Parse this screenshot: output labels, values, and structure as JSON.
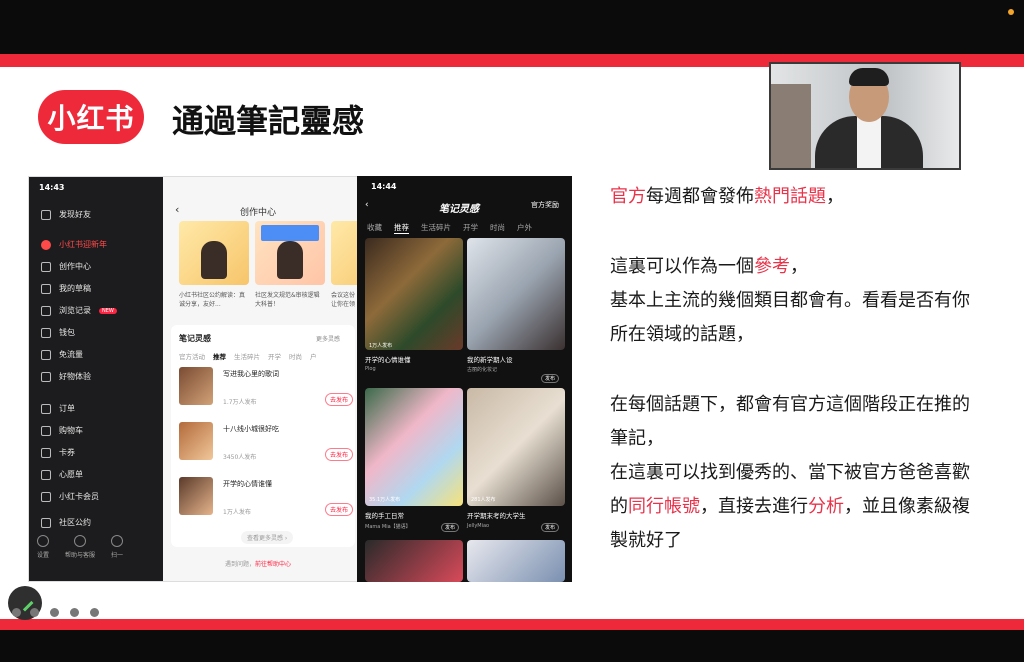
{
  "slide": {
    "logo_text": "小红书",
    "title": "通過筆記靈感",
    "accent_color": "#ee2a3a"
  },
  "phone_left": {
    "status_time": "14:43",
    "menu": [
      {
        "label": "发现好友",
        "icon": "add-friend-icon"
      },
      {
        "label": "小红书迎新年",
        "icon": "lantern-icon",
        "highlight": true
      },
      {
        "label": "创作中心",
        "icon": "creator-icon"
      },
      {
        "label": "我的草稿",
        "icon": "draft-icon"
      },
      {
        "label": "浏览记录",
        "icon": "history-icon",
        "badge": "NEW"
      },
      {
        "label": "钱包",
        "icon": "wallet-icon"
      },
      {
        "label": "免流量",
        "icon": "data-icon"
      },
      {
        "label": "好物体验",
        "icon": "gift-icon"
      },
      {
        "label": "订单",
        "icon": "order-icon"
      },
      {
        "label": "购物车",
        "icon": "cart-icon"
      },
      {
        "label": "卡券",
        "icon": "coupon-icon"
      },
      {
        "label": "心愿单",
        "icon": "wishlist-icon"
      },
      {
        "label": "小红卡会员",
        "icon": "member-icon"
      },
      {
        "label": "社区公约",
        "icon": "rules-icon"
      }
    ],
    "bottom": [
      {
        "label": "设置",
        "icon": "settings-icon"
      },
      {
        "label": "帮助与客服",
        "icon": "help-icon"
      },
      {
        "label": "扫一",
        "icon": "scan-icon"
      }
    ],
    "creator": {
      "title": "创作中心",
      "card_descs": [
        "小红书社区公约解读：真诚分享，友好...",
        "社区发文规范&审核逻辑大科普！",
        "会议这份让你在领"
      ],
      "inspo_title": "笔记灵感",
      "inspo_more": "更多灵感",
      "tabs": [
        "官方活动",
        "推荐",
        "生活碎片",
        "开学",
        "时尚",
        "户"
      ],
      "active_tab": "推荐",
      "items": [
        {
          "title": "写进我心里的歌词",
          "count": "1.7万人发布",
          "button": "去发布"
        },
        {
          "title": "十八线小城很好吃",
          "count": "3450人发布",
          "button": "去发布"
        },
        {
          "title": "开学的心情谁懂",
          "count": "1万人发布",
          "button": "去发布"
        }
      ],
      "see_more": "查看更多灵感 ›",
      "help_prefix": "遇到问题，",
      "help_link": "前往帮助中心"
    }
  },
  "phone_right": {
    "status_time": "14:44",
    "title": "笔记灵感",
    "award": "官方奖励",
    "tabs": [
      "收藏",
      "推荐",
      "生活碎片",
      "开学",
      "时尚",
      "户外"
    ],
    "active_tab": "推荐",
    "tiles": [
      {
        "caption": "开学的心情谁懂",
        "user": "Plog",
        "count": "1万人发布",
        "button": "发布"
      },
      {
        "caption": "我的新学期人设",
        "user": "古丽的化妆记",
        "count": "",
        "button": "发布"
      },
      {
        "caption": "我的手工日常",
        "user": "Mama Mia【猫语】",
        "count": "35.1万人发布",
        "button": "发布"
      },
      {
        "caption": "开学期末考的大学生",
        "user": "JellyMiao",
        "count": "281人发布",
        "button": "发布"
      }
    ]
  },
  "notes": {
    "line1": [
      "官方",
      "每週都會發佈",
      "熱門話題",
      "，"
    ],
    "line2": [
      "這裏可以作為一個",
      "參考",
      "，"
    ],
    "line3": "基本上主流的幾個類目都會有。看看是否有你",
    "line4": "所在領域的話題，",
    "line5": "在每個話題下，都會有官方這個階段正在推的",
    "line6": "筆記，",
    "line7": "在這裏可以找到優秀的、當下被官方爸爸喜歡",
    "line8": [
      "的",
      "同行帳號",
      "，直接去進行",
      "分析",
      "，並且像素級複"
    ],
    "line9": "製就好了",
    "highlight_color": "#e8334a"
  }
}
